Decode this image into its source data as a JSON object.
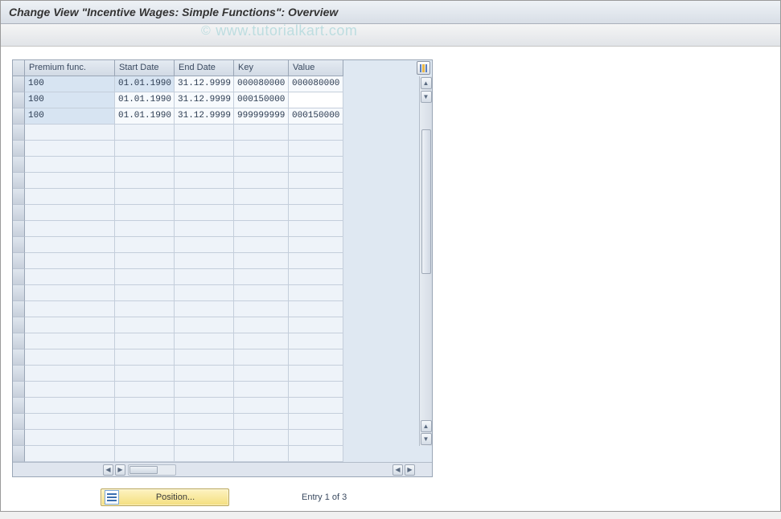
{
  "title": "Change View \"Incentive Wages: Simple Functions\": Overview",
  "watermark": "www.tutorialkart.com",
  "columns": {
    "premium": "Premium func.",
    "start": "Start Date",
    "end": "End Date",
    "key": "Key",
    "value": "Value"
  },
  "rows": [
    {
      "premium": "100",
      "start": "01.01.1990",
      "end": "31.12.9999",
      "key": "000080000",
      "value": "000080000",
      "start_hl": true,
      "value_editable": false
    },
    {
      "premium": "100",
      "start": "01.01.1990",
      "end": "31.12.9999",
      "key": "000150000",
      "value": "",
      "start_hl": false,
      "value_editable": true
    },
    {
      "premium": "100",
      "start": "01.01.1990",
      "end": "31.12.9999",
      "key": "999999999",
      "value": "000150000",
      "start_hl": false,
      "value_editable": false
    }
  ],
  "empty_row_count": 21,
  "footer": {
    "position_label": "Position...",
    "entry_text": "Entry 1 of 3"
  },
  "icons": {
    "config": "table-config-icon",
    "up": "▲",
    "down": "▼",
    "left": "◀",
    "right": "▶"
  }
}
